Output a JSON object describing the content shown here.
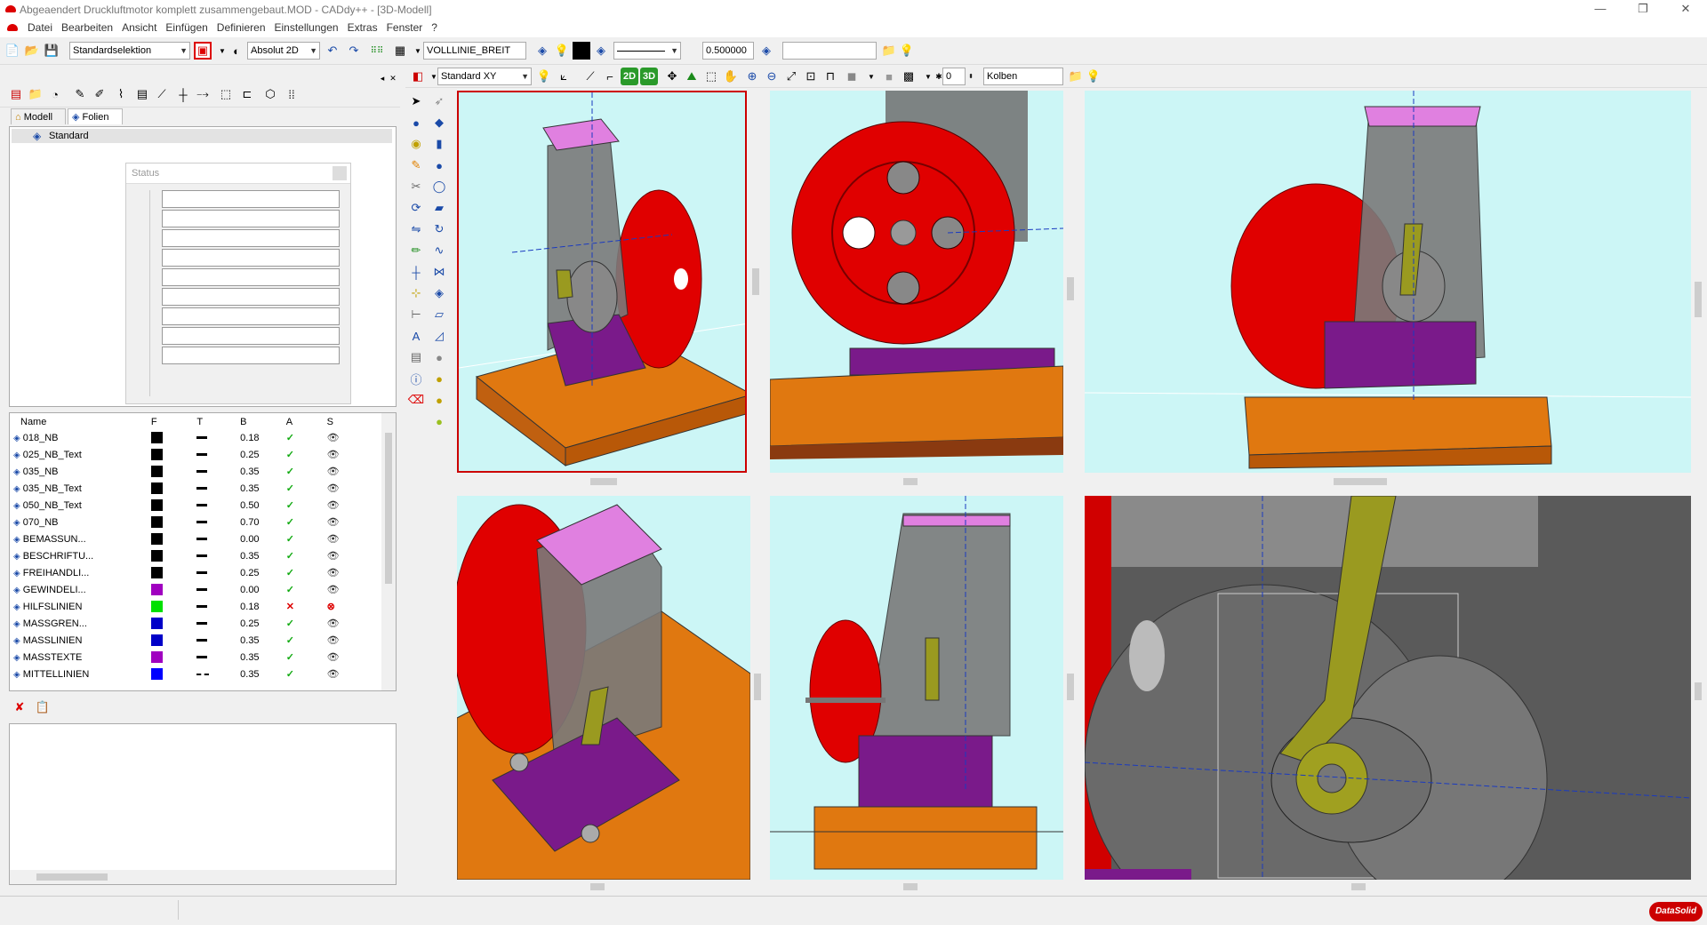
{
  "window": {
    "title": "Abgeaendert Druckluftmotor komplett zusammengebaut.MOD - CADdy++ - [3D-Modell]",
    "min": "—",
    "restore": "❐",
    "close": "✕"
  },
  "menu": {
    "items": [
      "Datei",
      "Bearbeiten",
      "Ansicht",
      "Einfügen",
      "Definieren",
      "Einstellungen",
      "Extras",
      "Fenster",
      "?"
    ]
  },
  "toolbar1": {
    "selection_mode": "Standardselektion",
    "coord_mode": "Absolut 2D",
    "line_type": "VOLLLINIE_BREIT",
    "line_width": "0.500000",
    "layer_field": ""
  },
  "toolbar2": {
    "view_plane": "Standard XY",
    "btn_2d": "2D",
    "btn_3d": "3D",
    "number_value": "0",
    "part_name": "Kolben"
  },
  "left_panel": {
    "tabs": [
      "Modell",
      "Folien"
    ],
    "tree_root": "Standard",
    "status_dialog_title": "Status",
    "columns": [
      "Name",
      "F",
      "T",
      "B",
      "A",
      "S"
    ],
    "layers": [
      {
        "name": "018_NB",
        "color": "#000000",
        "line": "solid",
        "b": "0.18",
        "a": "ok",
        "s": "eye"
      },
      {
        "name": "025_NB_Text",
        "color": "#000000",
        "line": "solid",
        "b": "0.25",
        "a": "ok",
        "s": "eye"
      },
      {
        "name": "035_NB",
        "color": "#000000",
        "line": "solid",
        "b": "0.35",
        "a": "ok",
        "s": "eye"
      },
      {
        "name": "035_NB_Text",
        "color": "#000000",
        "line": "solid",
        "b": "0.35",
        "a": "ok",
        "s": "eye"
      },
      {
        "name": "050_NB_Text",
        "color": "#000000",
        "line": "solid",
        "b": "0.50",
        "a": "ok",
        "s": "eye"
      },
      {
        "name": "070_NB",
        "color": "#000000",
        "line": "solid",
        "b": "0.70",
        "a": "ok",
        "s": "eye"
      },
      {
        "name": "BEMASSUN...",
        "color": "#000000",
        "line": "solid",
        "b": "0.00",
        "a": "ok",
        "s": "eye"
      },
      {
        "name": "BESCHRIFTU...",
        "color": "#000000",
        "line": "solid",
        "b": "0.35",
        "a": "ok",
        "s": "eye"
      },
      {
        "name": "FREIHANDLI...",
        "color": "#000000",
        "line": "solid",
        "b": "0.25",
        "a": "ok",
        "s": "eye"
      },
      {
        "name": "GEWINDELI...",
        "color": "#a000c0",
        "line": "solid",
        "b": "0.00",
        "a": "ok",
        "s": "eye"
      },
      {
        "name": "HILFSLINIEN",
        "color": "#00e000",
        "line": "solid",
        "b": "0.18",
        "a": "no",
        "s": "hidden"
      },
      {
        "name": "MASSGREN...",
        "color": "#0000c8",
        "line": "solid",
        "b": "0.25",
        "a": "ok",
        "s": "eye"
      },
      {
        "name": "MASSLINIEN",
        "color": "#0000c8",
        "line": "solid",
        "b": "0.35",
        "a": "ok",
        "s": "eye"
      },
      {
        "name": "MASSTEXTE",
        "color": "#a000c0",
        "line": "solid",
        "b": "0.35",
        "a": "ok",
        "s": "eye"
      },
      {
        "name": "MITTELLINIEN",
        "color": "#0000ff",
        "line": "dashed",
        "b": "0.35",
        "a": "ok",
        "s": "eye"
      }
    ]
  },
  "brand": "DataSolid",
  "colors": {
    "viewport_bg": "#ccf6f6",
    "flywheel": "#e00000",
    "base": "#e07810",
    "bracket": "#7a1a8a",
    "cap": "#e080e0",
    "rod": "#9a9a20",
    "body": "#6e6e6e"
  }
}
